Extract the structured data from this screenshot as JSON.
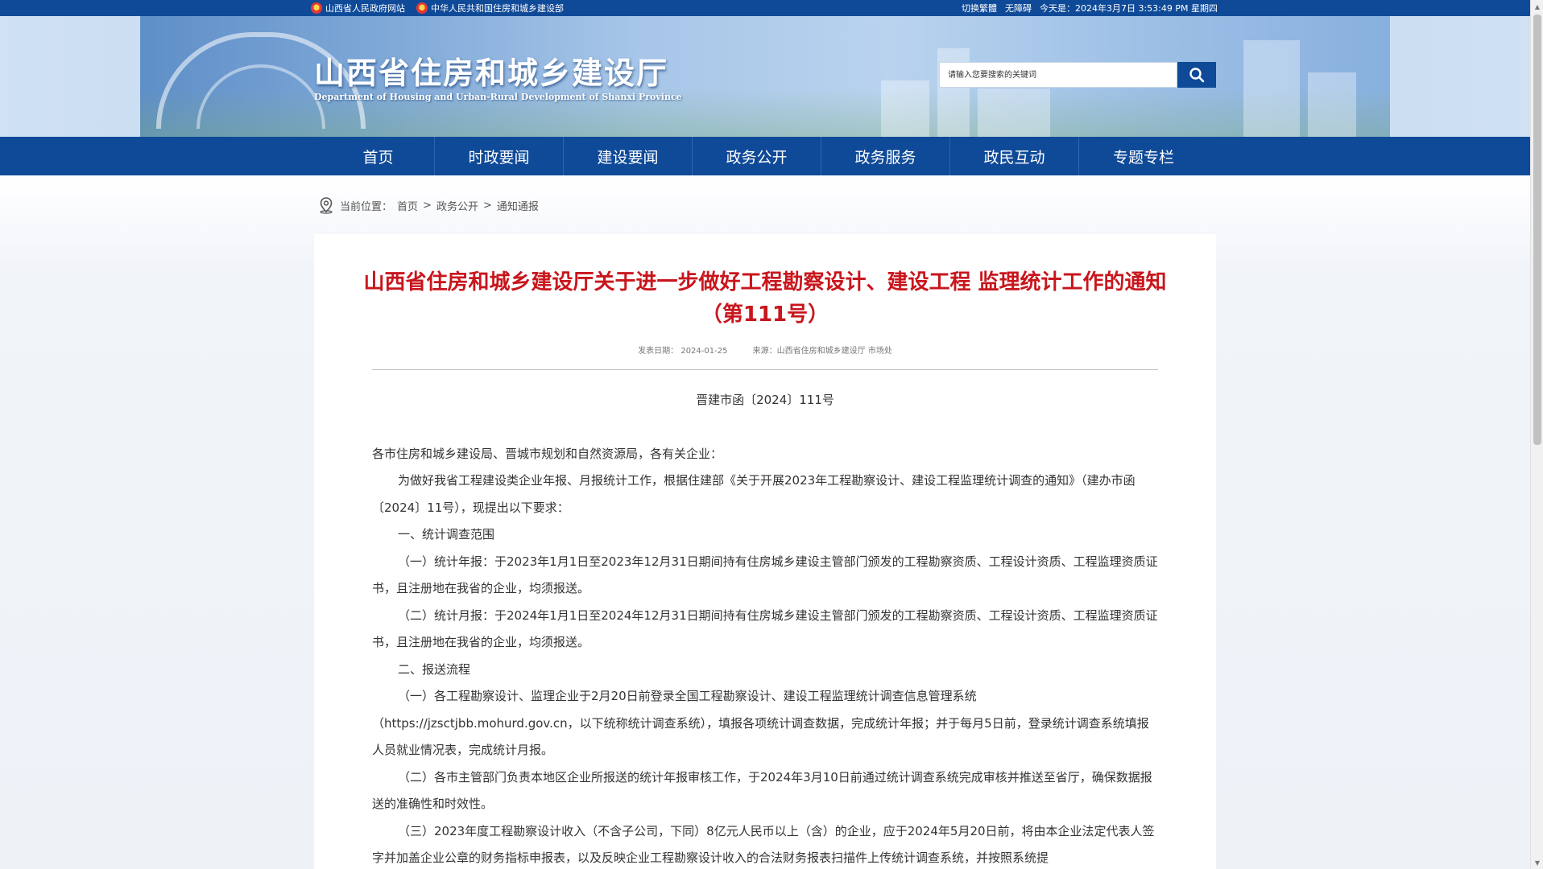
{
  "topbar": {
    "links": [
      "山西省人民政府网站",
      "中华人民共和国住房和城乡建设部"
    ],
    "switch_lang": "切换繁體",
    "accessibility": "无障碍",
    "today": "今天是：2024年3月7日 3:53:49 PM 星期四"
  },
  "header": {
    "title": "山西省住房和城乡建设厅",
    "subtitle": "Department of Housing and Urban-Rural Development of Shanxi Province",
    "search_placeholder": "请输入您要搜索的关键词"
  },
  "nav": {
    "items": [
      "首页",
      "时政要闻",
      "建设要闻",
      "政务公开",
      "政务服务",
      "政民互动",
      "专题专栏"
    ]
  },
  "breadcrumb": {
    "label": "当前位置：",
    "items": [
      "首页",
      "政务公开",
      "通知通报"
    ],
    "sep": ">"
  },
  "article": {
    "title": "山西省住房和城乡建设厅关于进一步做好工程勘察设计、建设工程 监理统计工作的通知（第111号）",
    "date": "发表日期： 2024-01-25",
    "source": "来源：山西省住房和城乡建设厅 市场处",
    "doc_no": "晋建市函〔2024〕111号",
    "paragraphs": [
      "各市住房和城乡建设局、晋城市规划和自然资源局，各有关企业：",
      "为做好我省工程建设类企业年报、月报统计工作，根据住建部《关于开展2023年工程勘察设计、建设工程监理统计调查的通知》（建办市函〔2024〕11号），现提出以下要求：",
      "一、统计调查范围",
      "（一）统计年报：于2023年1月1日至2023年12月31日期间持有住房城乡建设主管部门颁发的工程勘察资质、工程设计资质、工程监理资质证书，且注册地在我省的企业，均须报送。",
      "（二）统计月报：于2024年1月1日至2024年12月31日期间持有住房城乡建设主管部门颁发的工程勘察资质、工程设计资质、工程监理资质证书，且注册地在我省的企业，均须报送。",
      "二、报送流程",
      "（一）各工程勘察设计、监理企业于2月20日前登录全国工程勘察设计、建设工程监理统计调查信息管理系统（https://jzsctjbb.mohurd.gov.cn，以下统称统计调查系统），填报各项统计调查数据，完成统计年报；并于每月5日前，登录统计调查系统填报人员就业情况表，完成统计月报。",
      "（二）各市主管部门负责本地区企业所报送的统计年报审核工作，于2024年3月10日前通过统计调查系统完成审核并推送至省厅，确保数据报送的准确性和时效性。",
      "（三）2023年度工程勘察设计收入（不含子公司，下同）8亿元人民币以上（含）的企业，应于2024年5月20日前，将由本企业法定代表人签字并加盖企业公章的财务指标申报表，以及反映企业工程勘察设计收入的合法财务报表扫描件上传统计调查系统，并按照系统提"
    ]
  },
  "colors": {
    "brand_blue": "#0f4a98",
    "title_red": "#c8161d"
  }
}
